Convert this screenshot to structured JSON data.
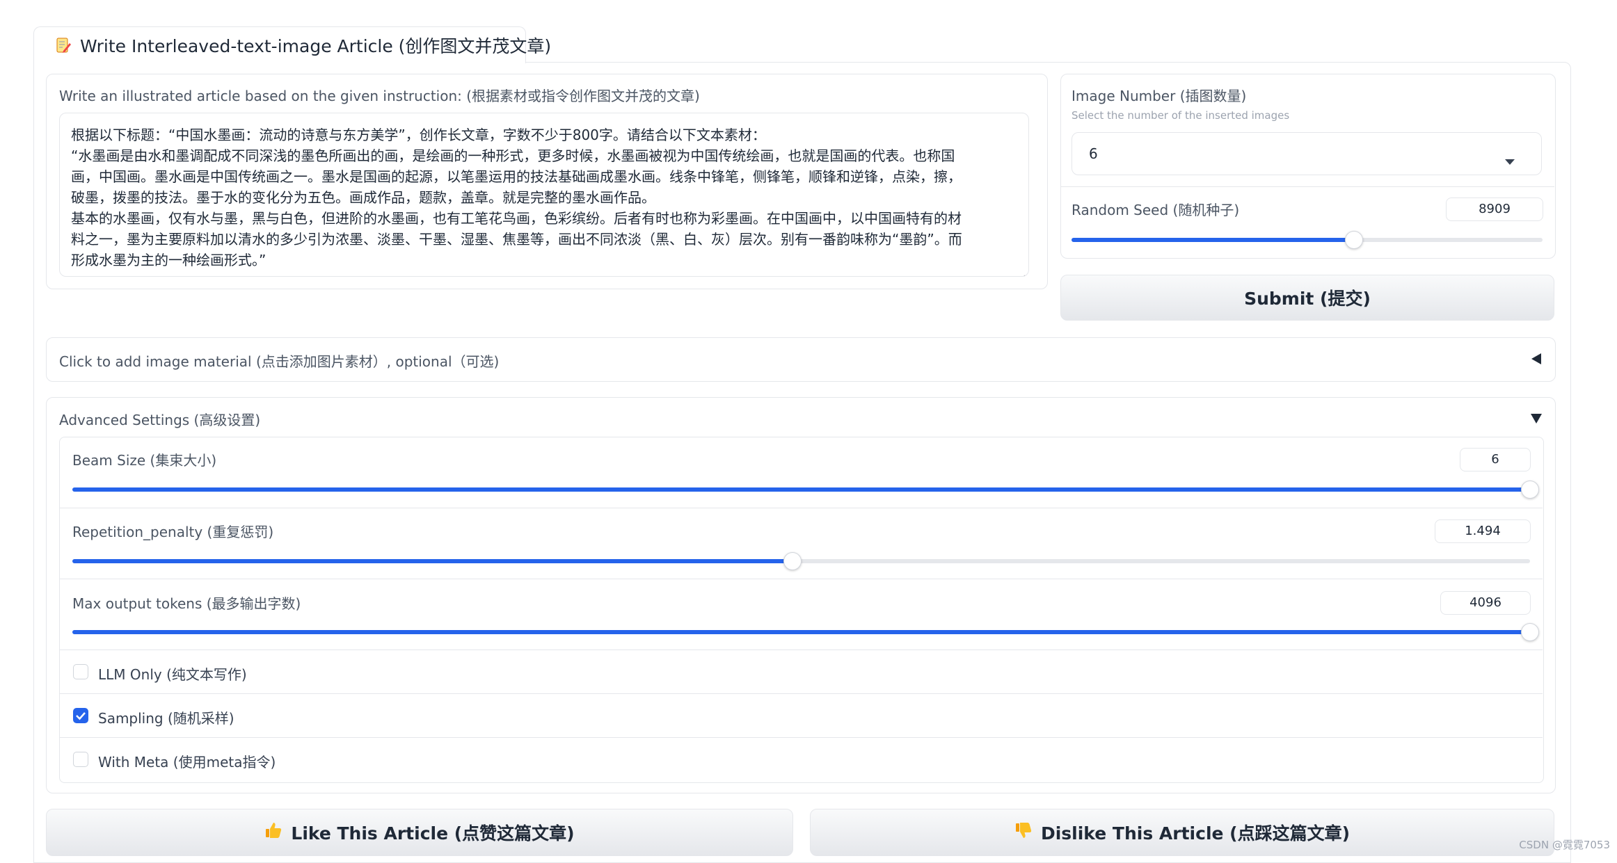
{
  "tab": {
    "label": "Write Interleaved-text-image Article (创作图文并茂文章)",
    "icon": "memo-pencil-icon"
  },
  "instruction": {
    "label": "Write an illustrated article based on the given instruction: (根据素材或指令创作图文并茂的文章)",
    "lines": [
      "根据以下标题：“中国水墨画：流动的诗意与东方美学”，创作长文章，字数不少于800字。请结合以下文本素材：",
      "“水墨画是由水和墨调配成不同深浅的墨色所画出的画，是绘画的一种形式，更多时候，水墨画被视为中国传统绘画，也就是国画的代表。也称国",
      "画，中国画。墨水画是中国传统画之一。墨水是国画的起源，以笔墨运用的技法基础画成墨水画。线条中锋笔，侧锋笔，顺锋和逆锋，点染，擦，",
      "破墨，拨墨的技法。墨于水的变化分为五色。画成作品，题款，盖章。就是完整的墨水画作品。",
      "基本的水墨画，仅有水与墨，黑与白色，但进阶的水墨画，也有工笔花鸟画，色彩缤纷。后者有时也称为彩墨画。在中国画中，以中国画特有的材",
      "料之一，墨为主要原料加以清水的多少引为浓墨、淡墨、干墨、湿墨、焦墨等，画出不同浓淡（黑、白、灰）层次。别有一番韵味称为“墨韵”。而",
      "形成水墨为主的一种绘画形式。”"
    ]
  },
  "image_number": {
    "label": "Image Number (插图数量)",
    "info": "Select the number of the inserted images",
    "value": "6"
  },
  "random_seed": {
    "label": "Random Seed (随机种子)",
    "value": "8909",
    "fraction": 0.6
  },
  "submit_label": "Submit (提交)",
  "image_material": {
    "label": "Click to add image material (点击添加图片素材）, optional（可选)",
    "icon": "collapse-left-triangle-icon"
  },
  "advanced": {
    "label": "Advanced Settings (高级设置)",
    "icon": "expand-down-triangle-icon",
    "beam": {
      "label": "Beam Size (集束大小)",
      "value": "6",
      "fraction": 1.0
    },
    "repetition": {
      "label": "Repetition_penalty (重复惩罚)",
      "value": "1.494",
      "fraction": 0.494
    },
    "max_tokens": {
      "label": "Max output tokens (最多输出字数)",
      "value": "4096",
      "fraction": 1.0
    },
    "llm_only": {
      "label": "LLM Only (纯文本写作)",
      "checked": false
    },
    "sampling": {
      "label": "Sampling (随机采样)",
      "checked": true
    },
    "with_meta": {
      "label": "With Meta (使用meta指令)",
      "checked": false
    }
  },
  "like_label": "Like This Article (点赞这篇文章)",
  "dislike_label": "Dislike This Article (点踩这篇文章)",
  "watermark": "CSDN @霓霓7053",
  "colors": {
    "accent": "#2563eb",
    "border": "#e5e7eb",
    "button_bg": "#f3f4f6"
  }
}
